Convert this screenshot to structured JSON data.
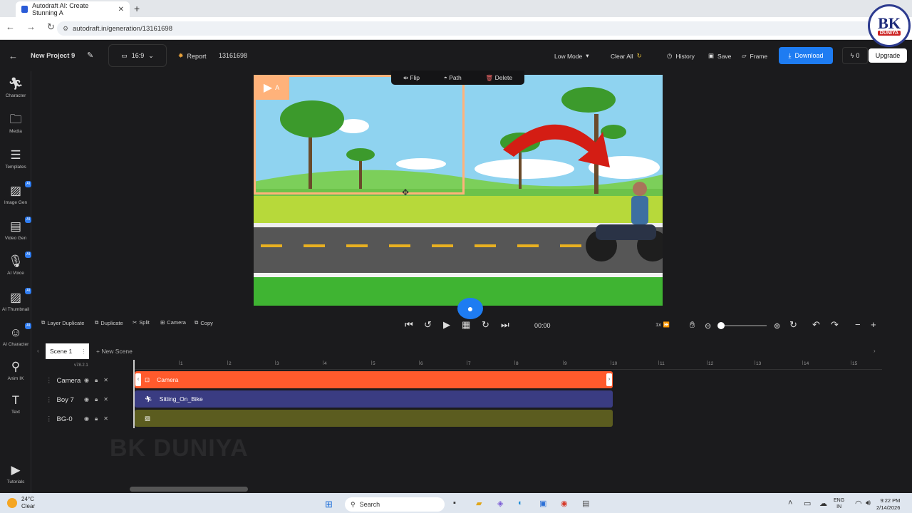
{
  "browser": {
    "tab_title": "Autodraft AI: Create Stunning A",
    "url": "autodraft.in/generation/13161698"
  },
  "watermark_badge": {
    "top": "BK",
    "bottom": "DUNIYA"
  },
  "header": {
    "project_name": "New Project 9",
    "aspect_ratio": "16:9",
    "report_label": "Report",
    "project_id": "13161698",
    "mode_label": "Low Mode",
    "clear_all_label": "Clear All",
    "history_label": "History",
    "save_label": "Save",
    "frame_label": "Frame",
    "download_label": "Download",
    "credits": "0",
    "upgrade_label": "Upgrade"
  },
  "sidebar": {
    "items": [
      {
        "label": "Character",
        "icon": "character-icon",
        "ai": false
      },
      {
        "label": "Media",
        "icon": "folder-icon",
        "ai": false
      },
      {
        "label": "Templates",
        "icon": "clapper-icon",
        "ai": false
      },
      {
        "label": "Image Gen",
        "icon": "image-ai-icon",
        "ai": true
      },
      {
        "label": "Video Gen",
        "icon": "video-ai-icon",
        "ai": true
      },
      {
        "label": "AI Voice",
        "icon": "mic-icon",
        "ai": true
      },
      {
        "label": "AI Thumbnail",
        "icon": "thumbnail-ai-icon",
        "ai": true
      },
      {
        "label": "AI Character",
        "icon": "ai-character-icon",
        "ai": true
      },
      {
        "label": "Anim IK",
        "icon": "anim-ik-icon",
        "ai": false
      },
      {
        "label": "Text",
        "icon": "text-icon",
        "ai": false
      },
      {
        "label": "Tutorials",
        "icon": "tutorials-icon",
        "ai": false
      }
    ],
    "ai_badge": "AI"
  },
  "context_bar": {
    "flip": "Flip",
    "path": "Path",
    "delete": "Delete"
  },
  "camera_marker": "A",
  "toolbar": {
    "layer_duplicate": "Layer Duplicate",
    "duplicate": "Duplicate",
    "split": "Split",
    "camera": "Camera",
    "copy": "Copy",
    "time": "00:00",
    "speed": "1x"
  },
  "scenes": {
    "active": "Scene 1",
    "new_scene": "+ New Scene"
  },
  "timeline": {
    "version": "v78.2.1",
    "ticks": [
      "1",
      "2",
      "3",
      "4",
      "5",
      "6",
      "7",
      "8",
      "9",
      "10",
      "11",
      "12",
      "13",
      "14",
      "15"
    ],
    "tracks": [
      {
        "name": "Camera",
        "clip": "Camera"
      },
      {
        "name": "Boy 7",
        "clip": "Sitting_On_Bike"
      },
      {
        "name": "BG-0",
        "clip": ""
      }
    ]
  },
  "overlay_watermark": "BK DUNIYA",
  "taskbar": {
    "temp": "24°C",
    "weather": "Clear",
    "search": "Search",
    "lang_top": "ENG",
    "lang_bottom": "IN",
    "time": "9:22 PM",
    "date": "2/14/2026"
  },
  "colors": {
    "accent": "#1e7cf2",
    "camera_track": "#ff5a2c",
    "boy_track": "#3a3c82",
    "bg_track": "#5b5c1f"
  }
}
